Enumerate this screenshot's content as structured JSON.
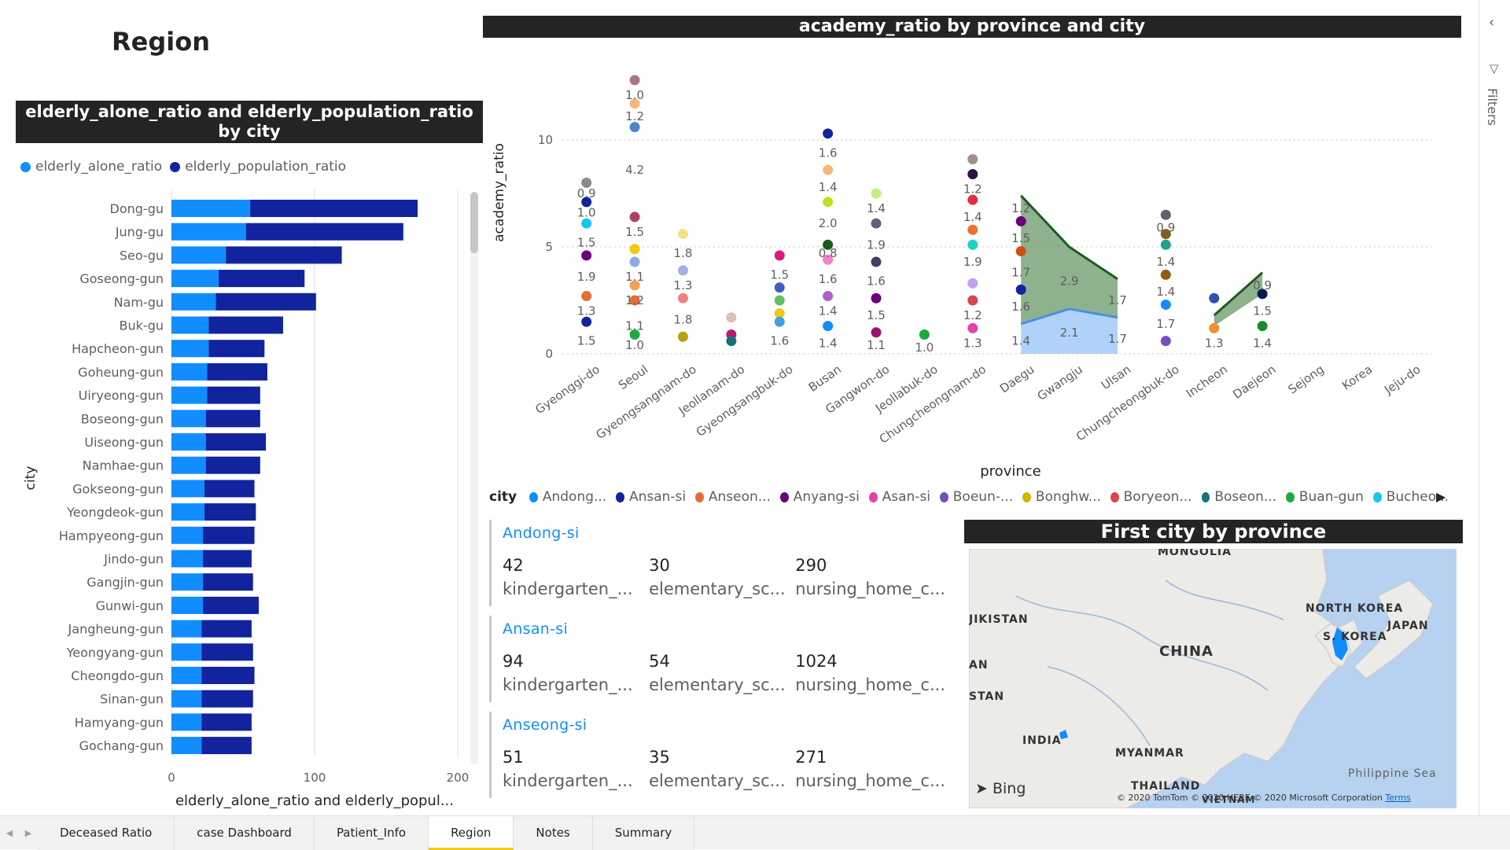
{
  "page": {
    "title": "Region"
  },
  "bar_visual": {
    "header": "elderly_alone_ratio and elderly_population_ratio by city",
    "legend": [
      {
        "label": "elderly_alone_ratio",
        "color": "#118dff"
      },
      {
        "label": "elderly_population_ratio",
        "color": "#12239e"
      }
    ],
    "yaxis_label": "city",
    "xaxis_label": "elderly_alone_ratio and elderly_popul..."
  },
  "academy_visual": {
    "header": "academy_ratio by province and city",
    "yaxis_label": "academy_ratio",
    "xaxis_label": "province",
    "legend_title": "city",
    "legend": [
      {
        "label": "Andong...",
        "color": "#118dff"
      },
      {
        "label": "Ansan-si",
        "color": "#12239e"
      },
      {
        "label": "Anseon...",
        "color": "#e66c37"
      },
      {
        "label": "Anyang-si",
        "color": "#6b007b"
      },
      {
        "label": "Asan-si",
        "color": "#e044a7"
      },
      {
        "label": "Boeun-...",
        "color": "#744ec2"
      },
      {
        "label": "Bonghw...",
        "color": "#d9b300"
      },
      {
        "label": "Boryeon...",
        "color": "#d64550"
      },
      {
        "label": "Boseon...",
        "color": "#197278"
      },
      {
        "label": "Buan-gun",
        "color": "#1aab40"
      },
      {
        "label": "Bucheo...",
        "color": "#15c6f4"
      }
    ]
  },
  "cards": [
    {
      "name": "Andong-si",
      "kindergarten": "42",
      "elementary": "30",
      "nursing": "290"
    },
    {
      "name": "Ansan-si",
      "kindergarten": "94",
      "elementary": "54",
      "nursing": "1024"
    },
    {
      "name": "Anseong-si",
      "kindergarten": "51",
      "elementary": "35",
      "nursing": "271"
    }
  ],
  "card_labels": {
    "kindergarten": "kindergarten_...",
    "elementary": "elementary_sc...",
    "nursing": "nursing_home_c..."
  },
  "map_visual": {
    "header": "First city by province",
    "labels": {
      "mongolia": "MONGOLIA",
      "kazakhstan": "JIKISTAN",
      "afghanistan": "AN",
      "pakistan": "STAN",
      "china": "CHINA",
      "north_korea": "NORTH KOREA",
      "south_korea": "S. KOREA",
      "japan": "JAPAN",
      "india": "INDIA",
      "myanmar": "MYANMAR",
      "thailand": "THAILAND",
      "vietnam": "VIETNAM",
      "philippine_sea": "Philippine Sea"
    },
    "bing": "Bing",
    "copyright": "© 2020 TomTom © 2020 HERE © 2020 Microsoft Corporation",
    "terms": "Terms"
  },
  "right_pane": {
    "filters_label": "Filters"
  },
  "tabs": [
    {
      "label": "Deceased Ratio",
      "active": false
    },
    {
      "label": "case Dashboard",
      "active": false
    },
    {
      "label": "Patient_Info",
      "active": false
    },
    {
      "label": "Region",
      "active": true
    },
    {
      "label": "Notes",
      "active": false
    },
    {
      "label": "Summary",
      "active": false
    }
  ],
  "chart_data": [
    {
      "type": "bar",
      "stacked": true,
      "orientation": "horizontal",
      "title": "elderly_alone_ratio and elderly_population_ratio by city",
      "ylabel": "city",
      "xlabel": "elderly_alone_ratio and elderly_popul...",
      "xlim": [
        0,
        200
      ],
      "xticks": [
        0,
        100,
        200
      ],
      "categories": [
        "Dong-gu",
        "Jung-gu",
        "Seo-gu",
        "Goseong-gun",
        "Nam-gu",
        "Buk-gu",
        "Hapcheon-gun",
        "Goheung-gun",
        "Uiryeong-gun",
        "Boseong-gun",
        "Uiseong-gun",
        "Namhae-gun",
        "Gokseong-gun",
        "Yeongdeok-gun",
        "Hampyeong-gun",
        "Jindo-gun",
        "Gangjin-gun",
        "Gunwi-gun",
        "Jangheung-gun",
        "Yeongyang-gun",
        "Cheongdo-gun",
        "Sinan-gun",
        "Hamyang-gun",
        "Gochang-gun"
      ],
      "series": [
        {
          "name": "elderly_alone_ratio",
          "values": [
            55,
            52,
            38,
            33,
            31,
            26,
            26,
            25,
            25,
            24,
            24,
            24,
            23,
            23,
            22,
            22,
            22,
            22,
            21,
            21,
            21,
            21,
            21,
            21
          ]
        },
        {
          "name": "elderly_population_ratio",
          "values": [
            117,
            110,
            81,
            60,
            70,
            52,
            39,
            42,
            37,
            38,
            42,
            38,
            35,
            36,
            36,
            34,
            35,
            39,
            35,
            36,
            37,
            36,
            35,
            35
          ]
        }
      ]
    },
    {
      "type": "scatter",
      "title": "academy_ratio by province and city",
      "xlabel": "province",
      "ylabel": "academy_ratio",
      "ylim": [
        0,
        12.5
      ],
      "yticks": [
        0,
        5,
        10
      ],
      "grid": true,
      "legend_placement": "bottom",
      "categories": [
        "Gyeonggi-do",
        "Seoul",
        "Gyeongsangnam-do",
        "Jeollanam-do",
        "Gyeongsangbuk-do",
        "Busan",
        "Gangwon-do",
        "Jeollabuk-do",
        "Chungcheongnam-do",
        "Daegu",
        "Gwangju",
        "Ulsan",
        "Chungcheongbuk-do",
        "Incheon",
        "Daejeon",
        "Sejong",
        "Korea",
        "Jeju-do"
      ],
      "points": [
        {
          "x": "Gyeonggi-do",
          "values": [
            8.0,
            7.1,
            6.1,
            4.6,
            2.7,
            1.5
          ],
          "colors": [
            "#8a8a8a",
            "#12239e",
            "#15c6f4",
            "#6b007b",
            "#e66c37",
            "#12239e"
          ]
        },
        {
          "x": "Seoul",
          "values": [
            12.8,
            11.7,
            10.6,
            6.4,
            4.9,
            4.3,
            3.2,
            2.5,
            0.9
          ],
          "colors": [
            "#b07090",
            "#f5b87a",
            "#4a86c8",
            "#b04060",
            "#f2c811",
            "#8fa8e0",
            "#f5a05a",
            "#e66c37",
            "#1aab40"
          ]
        },
        {
          "x": "Gyeongsangnam-do",
          "values": [
            5.6,
            3.9,
            2.6,
            0.8
          ],
          "colors": [
            "#f5e08a",
            "#a0b0e0",
            "#f08080",
            "#b8a010"
          ]
        },
        {
          "x": "Jeollanam-do",
          "values": [
            1.7,
            0.9,
            0.6
          ],
          "colors": [
            "#d9c0b0",
            "#c0186c",
            "#197278"
          ]
        },
        {
          "x": "Gyeongsangbuk-do",
          "values": [
            4.6,
            3.1,
            2.5,
            1.9,
            1.5
          ],
          "colors": [
            "#e0187c",
            "#4060c0",
            "#60c060",
            "#f2c811",
            "#40a0e0"
          ]
        },
        {
          "x": "Busan",
          "values": [
            10.3,
            8.6,
            7.1,
            5.1,
            4.4,
            2.7,
            1.3
          ],
          "colors": [
            "#12239e",
            "#f5b87a",
            "#c0e020",
            "#1a5c1a",
            "#f080d0",
            "#b060c0",
            "#118dff"
          ]
        },
        {
          "x": "Gangwon-do",
          "values": [
            7.5,
            6.1,
            4.3,
            2.6,
            1.0
          ],
          "colors": [
            "#c0f080",
            "#606080",
            "#404060",
            "#6b007b",
            "#a01070"
          ]
        },
        {
          "x": "Jeollabuk-do",
          "values": [
            0.9
          ],
          "colors": [
            "#1aab40"
          ]
        },
        {
          "x": "Chungcheongnam-do",
          "values": [
            9.1,
            8.4,
            7.2,
            5.8,
            5.1,
            3.3,
            2.5,
            1.2
          ],
          "colors": [
            "#a09090",
            "#301040",
            "#e03040",
            "#f07030",
            "#20d0c0",
            "#c0a0f0",
            "#d64550",
            "#e044a7"
          ]
        },
        {
          "x": "Daegu",
          "values": [
            6.2,
            4.8,
            3.0
          ],
          "colors": [
            "#6b007b",
            "#d05010",
            "#12239e"
          ]
        },
        {
          "x": "Chungcheongbuk-do",
          "values": [
            6.5,
            5.6,
            5.1,
            3.7,
            2.3,
            0.6
          ],
          "colors": [
            "#606070",
            "#806020",
            "#20a090",
            "#906010",
            "#118dff",
            "#744ec2"
          ]
        },
        {
          "x": "Incheon",
          "values": [
            2.6,
            1.2
          ],
          "colors": [
            "#3050b0",
            "#f09030"
          ]
        },
        {
          "x": "Daejeon",
          "values": [
            2.8,
            1.3
          ],
          "colors": [
            "#0a1a50",
            "#1a8a30"
          ]
        }
      ],
      "data_labels": [
        {
          "x": "Gyeonggi-do",
          "labels": [
            "0.9",
            "1.0",
            "1.5",
            "1.9",
            "1.3",
            "1.5"
          ],
          "y": [
            7.5,
            6.6,
            5.2,
            3.6,
            2.0,
            0.6
          ]
        },
        {
          "x": "Seoul",
          "labels": [
            "1.0",
            "1.2",
            "4.2",
            "1.5",
            "1.1",
            "1.2",
            "1.1",
            "1.0"
          ],
          "y": [
            12.1,
            11.1,
            8.6,
            5.7,
            3.6,
            2.5,
            1.3,
            0.4
          ]
        },
        {
          "x": "Gyeongsangnam-do",
          "labels": [
            "1.8",
            "1.3",
            "1.8"
          ],
          "y": [
            4.7,
            3.2,
            1.6
          ]
        },
        {
          "x": "Gyeongsangbuk-do",
          "labels": [
            "1.5",
            "1.6"
          ],
          "y": [
            3.7,
            0.6
          ]
        },
        {
          "x": "Busan",
          "labels": [
            "1.6",
            "1.4",
            "2.0",
            "0.8",
            "1.6",
            "1.4",
            "1.4"
          ],
          "y": [
            9.4,
            7.8,
            6.1,
            4.7,
            3.5,
            2.0,
            0.5
          ]
        },
        {
          "x": "Gangwon-do",
          "labels": [
            "1.4",
            "1.9",
            "1.6",
            "1.5",
            "1.1"
          ],
          "y": [
            6.8,
            5.1,
            3.4,
            1.8,
            0.4
          ]
        },
        {
          "x": "Jeollabuk-do",
          "labels": [
            "1.0"
          ],
          "y": [
            0.3
          ]
        },
        {
          "x": "Chungcheongnam-do",
          "labels": [
            "1.2",
            "1.4",
            "1.9",
            "1.2",
            "1.3"
          ],
          "y": [
            7.7,
            6.4,
            4.3,
            1.8,
            0.5
          ]
        },
        {
          "x": "Daegu",
          "labels": [
            "1.2",
            "1.5",
            "1.7",
            "1.6",
            "1.4"
          ],
          "y": [
            6.8,
            5.4,
            3.8,
            2.2,
            0.6
          ]
        },
        {
          "x": "Gwangju",
          "labels": [
            "2.9",
            "2.1"
          ],
          "y": [
            3.4,
            1.0
          ]
        },
        {
          "x": "Ulsan",
          "labels": [
            "1.7",
            "1.7"
          ],
          "y": [
            2.5,
            0.7
          ]
        },
        {
          "x": "Chungcheongbuk-do",
          "labels": [
            "0.9",
            "1.4",
            "1.4",
            "1.7"
          ],
          "y": [
            5.9,
            4.3,
            2.9,
            1.4
          ]
        },
        {
          "x": "Incheon",
          "labels": [
            "1.3"
          ],
          "y": [
            0.5
          ]
        },
        {
          "x": "Daejeon",
          "labels": [
            "0.9",
            "1.5",
            "1.4"
          ],
          "y": [
            3.2,
            2.0,
            0.5
          ]
        }
      ],
      "areas": [
        {
          "color": "#5a8a5a",
          "x": [
            "Daegu",
            "Gwangju",
            "Ulsan"
          ],
          "upper": [
            7.4,
            5.0,
            3.5
          ],
          "lower": [
            1.4,
            2.1,
            1.7
          ]
        },
        {
          "color": "#5a8a5a",
          "x": [
            "Incheon",
            "Daejeon"
          ],
          "upper": [
            1.8,
            3.8
          ],
          "lower": [
            1.3,
            2.8
          ]
        },
        {
          "color": "#118dff",
          "x": [
            "Daegu",
            "Gwangju",
            "Ulsan"
          ],
          "upper": [
            1.4,
            2.1,
            1.7
          ],
          "lower": [
            0,
            0,
            0
          ]
        }
      ]
    }
  ]
}
